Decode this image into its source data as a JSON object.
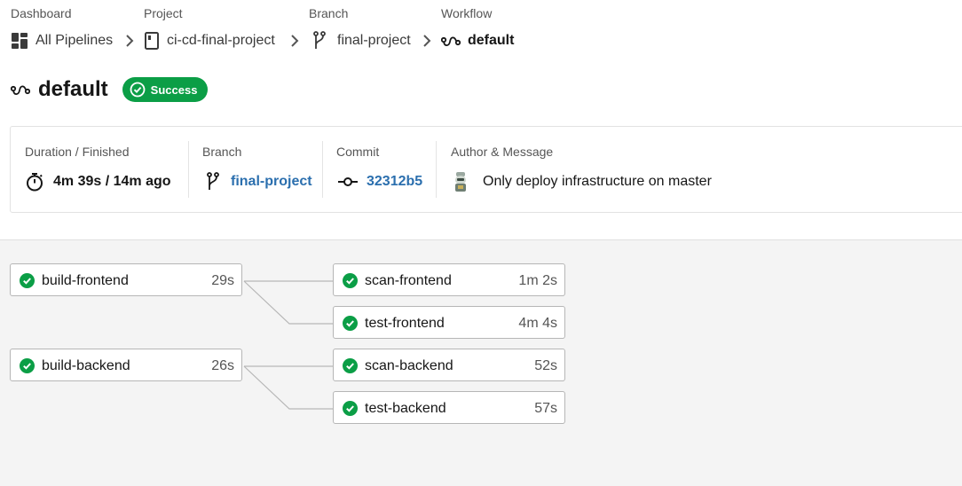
{
  "breadcrumb": [
    {
      "label": "Dashboard",
      "value": "All Pipelines",
      "icon": "dashboard-icon"
    },
    {
      "label": "Project",
      "value": "ci-cd-final-project",
      "icon": "repo-icon"
    },
    {
      "label": "Branch",
      "value": "final-project",
      "icon": "branch-icon"
    },
    {
      "label": "Workflow",
      "value": "default",
      "icon": "workflow-icon"
    }
  ],
  "title": "default",
  "status": {
    "label": "Success",
    "color": "#0b9e46"
  },
  "summary": {
    "duration": {
      "label": "Duration / Finished",
      "value": "4m 39s / 14m ago"
    },
    "branch": {
      "label": "Branch",
      "value": "final-project"
    },
    "commit": {
      "label": "Commit",
      "value": "32312b5"
    },
    "author": {
      "label": "Author & Message",
      "value": "Only deploy infrastructure on master"
    }
  },
  "jobs": [
    {
      "name": "build-frontend",
      "duration": "29s",
      "status": "success"
    },
    {
      "name": "scan-frontend",
      "duration": "1m 2s",
      "status": "success"
    },
    {
      "name": "test-frontend",
      "duration": "4m 4s",
      "status": "success"
    },
    {
      "name": "build-backend",
      "duration": "26s",
      "status": "success"
    },
    {
      "name": "scan-backend",
      "duration": "52s",
      "status": "success"
    },
    {
      "name": "test-backend",
      "duration": "57s",
      "status": "success"
    }
  ],
  "colors": {
    "success": "#0b9e46",
    "link": "#2b6fae"
  }
}
